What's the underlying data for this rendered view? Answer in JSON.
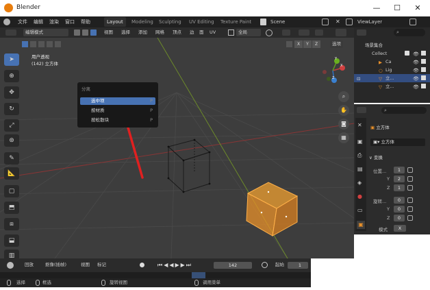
{
  "window": {
    "title": "Blender",
    "minimize": "—",
    "maximize": "☐",
    "close": "✕"
  },
  "menubar": {
    "items": [
      "文件",
      "编辑",
      "渲染",
      "窗口",
      "帮助"
    ],
    "workspaces": [
      "Layout",
      "Modeling",
      "Sculpting",
      "UV Editing",
      "Texture Paint"
    ],
    "scene": "Scene",
    "view_layer": "ViewLayer"
  },
  "header": {
    "mode": "编辑模式",
    "menus": [
      "视图",
      "选择",
      "添加",
      "网格",
      "顶点",
      "边",
      "面",
      "UV"
    ],
    "transform_orientation": "全局",
    "xyz": [
      "X",
      "Y",
      "Z"
    ],
    "options": "选项"
  },
  "viewport": {
    "overlay_line1": "用户透视",
    "overlay_line2": "(142) 立方体",
    "gizmo": {
      "x": "X",
      "y": "Y",
      "z": "Z"
    }
  },
  "popup": {
    "title": "分离",
    "items": [
      {
        "label": "选中项",
        "key": "P"
      },
      {
        "label": "按材质",
        "key": "P"
      },
      {
        "label": "按松散块",
        "key": "P"
      }
    ]
  },
  "outliner": {
    "root": "场景集合",
    "collection": "Collect",
    "rows": [
      "Ca",
      "Lig",
      "立...",
      "立..."
    ]
  },
  "properties": {
    "object_name": "立方体",
    "data_name": "立方体",
    "section": "变换",
    "location_label": "位置...",
    "location": [
      {
        "axis": "",
        "value": "1"
      },
      {
        "axis": "Y",
        "value": "2"
      },
      {
        "axis": "Z",
        "value": "1"
      }
    ],
    "rotation_label": "旋转...",
    "rotation": [
      {
        "axis": "",
        "value": "0"
      },
      {
        "axis": "Y",
        "value": "0"
      },
      {
        "axis": "Z",
        "value": "0"
      }
    ],
    "mode_label": "模式",
    "mode_value": "X"
  },
  "timeline": {
    "playback": "回放",
    "keying": "抠像(插帧)",
    "view": "视图",
    "marker": "标记",
    "current_frame": "142",
    "start_label": "起始",
    "start_value": "1"
  },
  "statusbar": {
    "select": "选择",
    "box_select": "框选",
    "rotate_view": "旋转视图",
    "call_menu": "调用菜单"
  },
  "colors": {
    "active_blue": "#4772b3",
    "selected_object": "#f0a030",
    "annotation_arrow": "#e02020"
  }
}
